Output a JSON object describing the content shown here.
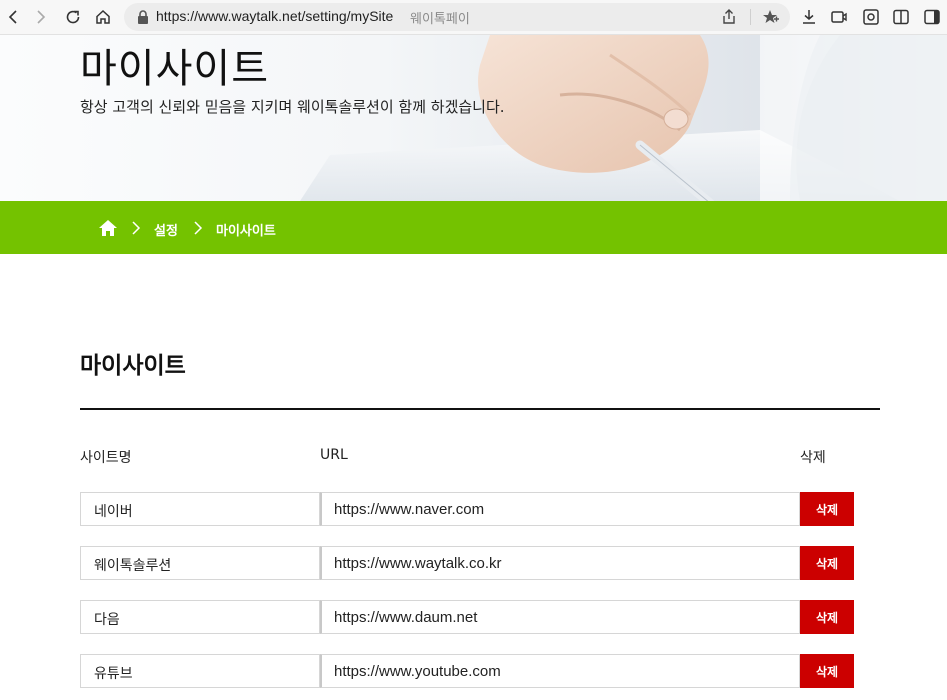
{
  "browser": {
    "url": "https://www.waytalk.net/setting/mySite",
    "tab_title": "웨이톡페이",
    "icons": [
      "back-icon",
      "forward-icon",
      "reload-icon",
      "home-icon",
      "lock-icon",
      "share-icon",
      "favorites-icon",
      "download-icon",
      "screen-capture-icon",
      "camera-icon",
      "split-view-icon",
      "sidebar-icon"
    ]
  },
  "hero": {
    "title": "마이사이트",
    "subtitle": "항상 고객의 신뢰와 믿음을 지키며 웨이톡솔루션이 함께 하겠습니다."
  },
  "breadcrumb": {
    "items": [
      "설정",
      "마이사이트"
    ],
    "background_color": "#74c200"
  },
  "content": {
    "title": "마이사이트",
    "columns": {
      "name": "사이트명",
      "url": "URL",
      "delete": "삭제"
    },
    "rows": [
      {
        "name": "네이버",
        "url": "https://www.naver.com",
        "delete_label": "삭제"
      },
      {
        "name": "웨이톡솔루션",
        "url": "https://www.waytalk.co.kr",
        "delete_label": "삭제"
      },
      {
        "name": "다음",
        "url": "https://www.daum.net",
        "delete_label": "삭제"
      },
      {
        "name": "유튜브",
        "url": "https://www.youtube.com",
        "delete_label": "삭제"
      }
    ],
    "delete_button_color": "#cc0000"
  }
}
